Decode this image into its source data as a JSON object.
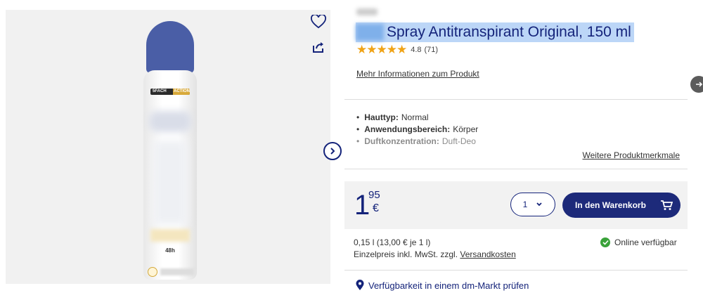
{
  "product": {
    "title": "Spray Antitranspirant Original, 150 ml",
    "rating_value": "4.8",
    "rating_count": "(71)",
    "stars": "★★★★★",
    "more_info_label": "Mehr Informationen zum Produkt",
    "features": [
      {
        "key": "Hauttyp:",
        "value": "Normal"
      },
      {
        "key": "Anwendungsbereich:",
        "value": "Körper"
      },
      {
        "key": "Duftkonzentration:",
        "value": "Duft-Deo"
      }
    ],
    "more_features_label": "Weitere Produktmerkmale"
  },
  "bottle": {
    "band_left": "5FACH",
    "band_right": "ACTION",
    "hours": "48h"
  },
  "purchase": {
    "price_int": "1",
    "price_dec": "95",
    "currency": "€",
    "quantity": "1",
    "cart_label": "In den Warenkorb"
  },
  "info": {
    "unit_price": "0,15 l (13,00 € je 1 l)",
    "vat_text": "Einzelpreis inkl. MwSt. zzgl.",
    "shipping_link": "Versandkosten",
    "availability": "Online verfügbar",
    "store_check": "Verfügbarkeit in einem dm-Markt prüfen"
  },
  "icons": [
    "heart-icon",
    "share-icon",
    "chevron-right-icon",
    "arrow-right-icon",
    "chevron-down-icon",
    "cart-icon",
    "check-icon",
    "location-pin-icon"
  ],
  "colors": {
    "accent": "#14237a",
    "star": "#f0a316",
    "available": "#3aa23a",
    "highlight": "#bcd6f7"
  }
}
